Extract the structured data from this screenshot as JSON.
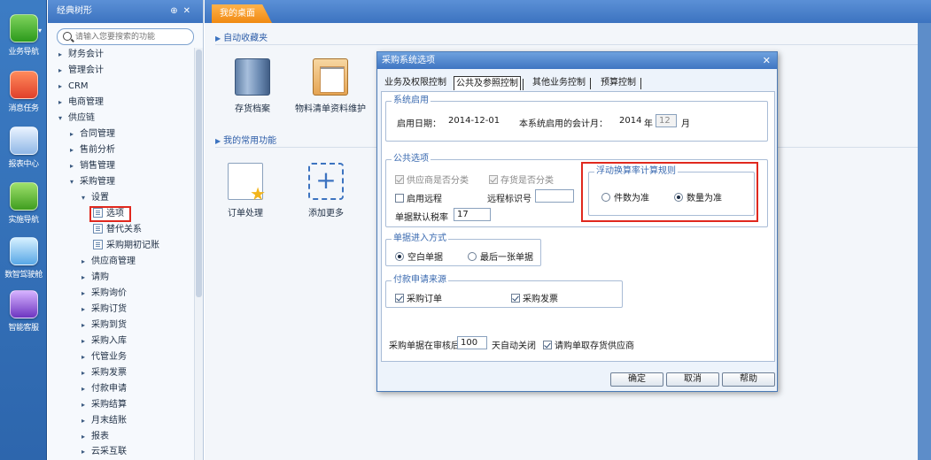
{
  "rail": {
    "items": [
      {
        "label": "业务导航",
        "icon": "grid-icon"
      },
      {
        "label": "消息任务",
        "icon": "message-icon"
      },
      {
        "label": "报表中心",
        "icon": "report-icon"
      },
      {
        "label": "实施导航",
        "icon": "compass-icon"
      },
      {
        "label": "数智驾驶舱",
        "icon": "cube-icon"
      },
      {
        "label": "智能客服",
        "icon": "robot-icon"
      }
    ],
    "dropdown": "▾"
  },
  "tree": {
    "title": "经典树形",
    "pin_glyph": "⊕",
    "close_glyph": "✕",
    "search_placeholder": "请输入您要搜索的功能",
    "nodes": {
      "n0": "财务会计",
      "n1": "管理会计",
      "n2": "CRM",
      "n3": "电商管理",
      "n4": "供应链",
      "n5": "合同管理",
      "n6": "售前分析",
      "n7": "销售管理",
      "n8": "采购管理",
      "n9": "设置",
      "n10": "选项",
      "n11": "替代关系",
      "n12": "采购期初记账",
      "n13": "供应商管理",
      "n14": "请购",
      "n15": "采购询价",
      "n16": "采购订货",
      "n17": "采购到货",
      "n18": "采购入库",
      "n19": "代管业务",
      "n20": "采购发票",
      "n21": "付款申请",
      "n22": "采购结算",
      "n23": "月末结账",
      "n24": "报表",
      "n25": "云采互联"
    }
  },
  "main": {
    "tab": "我的桌面",
    "favorites": {
      "title": "自动收藏夹",
      "items": [
        {
          "label": "存货档案",
          "icon": "books-icon"
        },
        {
          "label": "物料清单资料维护",
          "icon": "clipboard-icon"
        }
      ]
    },
    "common": {
      "title": "我的常用功能",
      "items": [
        {
          "label": "订单处理",
          "icon": "order-star-icon"
        },
        {
          "label": "添加更多",
          "icon": "add-icon"
        }
      ]
    }
  },
  "dialog": {
    "title": "采购系统选项",
    "close": "✕",
    "tabs": [
      "业务及权限控制",
      "公共及参照控制",
      "其他业务控制",
      "预算控制"
    ],
    "active_tab": "公共及参照控制",
    "system": {
      "title": "系统启用",
      "start_date_label": "启用日期：",
      "start_date": "2014-12-01",
      "period_label": "本系统启用的会计月：",
      "year": "2014",
      "year_unit": "年",
      "month": "12",
      "month_unit": "月"
    },
    "common": {
      "title": "公共选项",
      "supplier_classified": "供应商是否分类",
      "inventory_classified": "存货是否分类",
      "enable_remote": "启用远程",
      "remote_id_label": "远程标识号",
      "remote_id": "",
      "tax_rate_label": "单据默认税率",
      "tax_rate": "17"
    },
    "float_rule": {
      "title": "浮动换算率计算规则",
      "opt_piece": "件数为准",
      "opt_qty": "数量为准",
      "selected": "数量为准"
    },
    "entry_mode": {
      "title": "单据进入方式",
      "opt_blank": "空白单据",
      "opt_last": "最后一张单据",
      "selected": "空白单据"
    },
    "payment_source": {
      "title": "付款申请来源",
      "opt_order": "采购订单",
      "opt_invoice": "采购发票"
    },
    "auto_close": {
      "prefix": "采购单据在审核后",
      "days": "100",
      "suffix": "天自动关闭"
    },
    "request_vendor": "请购单取存货供应商",
    "buttons": {
      "ok": "确定",
      "cancel": "取消",
      "help": "帮助"
    }
  }
}
